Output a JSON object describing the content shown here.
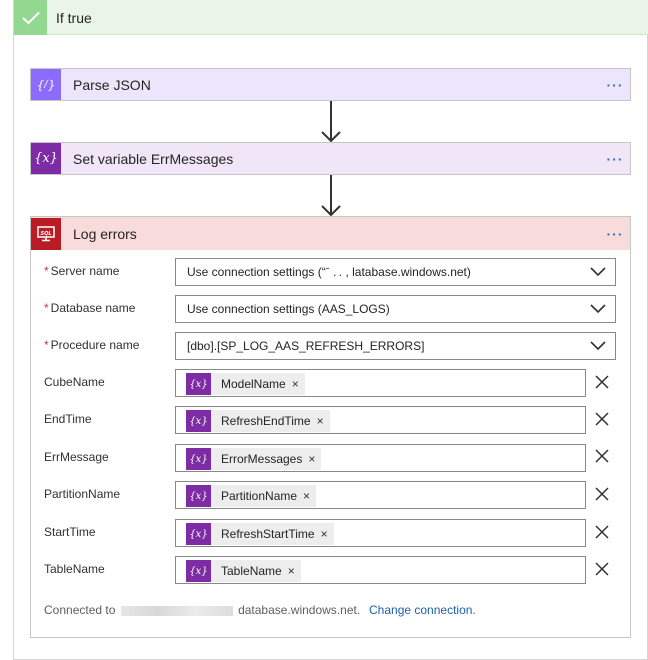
{
  "scope": {
    "title": "If true"
  },
  "cards": {
    "parse_json": {
      "title": "Parse JSON",
      "more": "···"
    },
    "set_variable": {
      "title": "Set variable ErrMessages",
      "more": "···"
    },
    "log_errors": {
      "title": "Log errors",
      "more": "···",
      "icon_text": "SQL"
    }
  },
  "fields": {
    "server": {
      "label": "Server name",
      "required": "*",
      "value": "Use connection settings (“ˉ   . .  ,    latabase.windows.net)"
    },
    "database": {
      "label": "Database name",
      "required": "*",
      "value": "Use connection settings (AAS_LOGS)"
    },
    "procedure": {
      "label": "Procedure name",
      "required": "*",
      "value": "[dbo].[SP_LOG_AAS_REFRESH_ERRORS]"
    },
    "params": [
      {
        "label": "CubeName",
        "token": "ModelName"
      },
      {
        "label": "EndTime",
        "token": "RefreshEndTime"
      },
      {
        "label": "ErrMessage",
        "token": "ErrorMessages"
      },
      {
        "label": "PartitionName",
        "token": "PartitionName"
      },
      {
        "label": "StartTime",
        "token": "RefreshStartTime"
      },
      {
        "label": "TableName",
        "token": "TableName"
      }
    ]
  },
  "token_icon_text": "{x}",
  "token_remove": "×",
  "connection": {
    "prefix": "Connected to",
    "suffix": "database.windows.net.",
    "change_link": "Change connection."
  },
  "colors": {
    "scope_header_bg": "#e9f5e6",
    "scope_check_bg": "#92d890",
    "parse_json_bg": "#ebe6fb",
    "parse_json_icon": "#8c6cff",
    "set_variable_bg": "#f0e6f8",
    "set_variable_icon": "#7d2ca6",
    "log_errors_bg": "#f8dcdc",
    "log_errors_icon": "#b91c24",
    "link": "#1f5faa"
  },
  "icons": {
    "scope": "checkmark-icon",
    "parse_json": "json-braces-icon",
    "set_variable": "variable-icon",
    "log_errors": "sql-icon",
    "more": "ellipsis-icon",
    "dropdown": "chevron-down-icon",
    "remove": "close-icon",
    "arrow": "arrow-down-icon"
  }
}
